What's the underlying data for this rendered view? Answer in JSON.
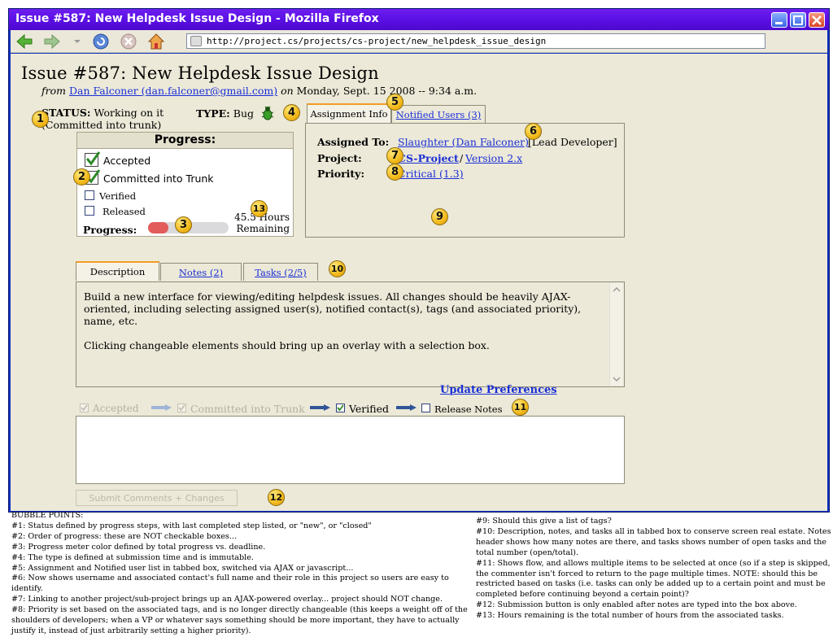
{
  "window": {
    "title": "Issue #587: New Helpdesk Issue Design - Mozilla Firefox"
  },
  "browser": {
    "url": "http://project.cs/projects/cs-project/new_helpdesk_issue_design"
  },
  "issue": {
    "title": "Issue #587: New Helpdesk Issue Design",
    "from_prefix": "from",
    "author": "Dan Falconer (dan.falconer@gmail.com)",
    "on_word": "on",
    "date": "Monday, Sept. 15 2008 -- 9:34 a.m."
  },
  "status": {
    "label": "STATUS:",
    "value": "Working on it",
    "sub": "(Committed into trunk)"
  },
  "type": {
    "label": "TYPE:",
    "value": "Bug"
  },
  "progress_box": {
    "header": "Progress:",
    "steps": [
      "Accepted",
      "Committed into Trunk",
      "Verified",
      "Released"
    ],
    "progress_label": "Progress:",
    "progress_fraction": 0.25,
    "hours_line1": "45.5 Hours",
    "hours_line2": "Remaining"
  },
  "assignment": {
    "tabs": [
      "Assignment Info",
      "Notified Users (3)"
    ],
    "assigned_label": "Assigned To:",
    "assigned_link": "Slaughter (Dan Falconer)",
    "assigned_role": "[Lead Developer]",
    "project_label": "Project:",
    "project_link": "CS-Project",
    "project_sep": "/",
    "version_link": "Version 2.x",
    "priority_label": "Priority:",
    "priority_link": "Critical (1.3)"
  },
  "detail_tabs": [
    "Description",
    "Notes (2)",
    "Tasks (2/5)"
  ],
  "description": {
    "p1": "Build a new interface for viewing/editing helpdesk issues.  All changes should be heavily AJAX-oriented, including selecting assigned user(s), notified contact(s), tags (and associated priority), name, etc.",
    "p2": "Clicking changeable elements should bring up an overlay with a selection box."
  },
  "update_prefs": "Update Preferences",
  "flow": {
    "accepted": "Accepted",
    "committed": "Committed into Trunk",
    "verified": "Verified",
    "release": "Release Notes"
  },
  "submit_label": "Submit Comments + Changes",
  "badges": [
    "1",
    "2",
    "3",
    "4",
    "5",
    "6",
    "7",
    "8",
    "9",
    "10",
    "11",
    "12",
    "13"
  ],
  "bubble_notes": {
    "heading": "BUBBLE POINTS:",
    "left": [
      "#1:  Status defined by progress steps, with last completed step listed, or \"new\", or \"closed\"",
      "#2:  Order of progress: these are NOT checkable boxes...",
      "#3:  Progress meter color defined by total progress vs. deadline.",
      "#4:  The type is defined at submission time and is immutable.",
      "#5:  Assignment and Notified user list in tabbed box, switched via AJAX or javascript...",
      "#6:  Now shows username and associated contact's full name and their role in this project so users are easy to identify.",
      "#7:  Linking to another project/sub-project brings up an AJAX-powered overlay... project should NOT change.",
      "#8:  Priority is set based on the associated tags, and is no longer directly changeable (this keeps a weight off of the shoulders of developers; when a VP or whatever says something should be more important, they have to actually justify it, instead of just arbitrarily setting a higher priority)."
    ],
    "right": [
      "#9:  Should this give a list of tags?",
      "#10: Description, notes, and tasks all in tabbed box to conserve screen real estate. Notes header shows how many notes are there, and tasks shows number of open tasks and the total number (open/total).",
      "#11: Shows flow, and allows multiple items to be selected at once (so if a step is skipped, the commenter isn't forced to return to the page multiple times.  NOTE: should this be restricted based on tasks (i.e. tasks can only be added up to a certain point and must be completed before continuing beyond a certain point)?",
      "#12: Submission button is only enabled after notes are typed into the box above.",
      "#13: Hours remaining is the total number of hours from the associated tasks."
    ]
  }
}
